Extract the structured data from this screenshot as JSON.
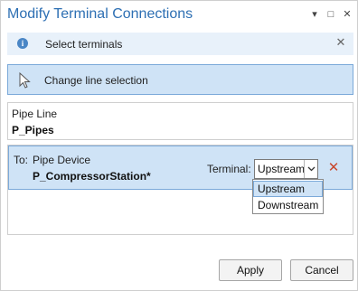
{
  "window": {
    "title": "Modify Terminal Connections"
  },
  "title_actions": {
    "dropdown_glyph": "▾",
    "restore_glyph": "□",
    "close_glyph": "✕"
  },
  "info": {
    "icon_glyph": "i",
    "text": "Select terminals",
    "close_glyph": "✕"
  },
  "change_selection": {
    "label": "Change line selection",
    "icon": "cursor-arrow-icon"
  },
  "pipe_line": {
    "label": "Pipe Line",
    "value": "P_Pipes"
  },
  "device": {
    "to_label": "To:",
    "label": "Pipe Device",
    "value": "P_CompressorStation*",
    "terminal_label": "Terminal:",
    "terminal_value": "Upstream",
    "delete_glyph": "✕"
  },
  "terminal_options": [
    "Upstream",
    "Downstream"
  ],
  "footer": {
    "apply_label": "Apply",
    "cancel_label": "Cancel"
  },
  "colors": {
    "accent": "#2d6fb3",
    "selection_bg": "#cfe3f6",
    "selection_border": "#7ba9d9",
    "info_bg": "#e8f1fa",
    "delete_red": "#c8472c"
  }
}
